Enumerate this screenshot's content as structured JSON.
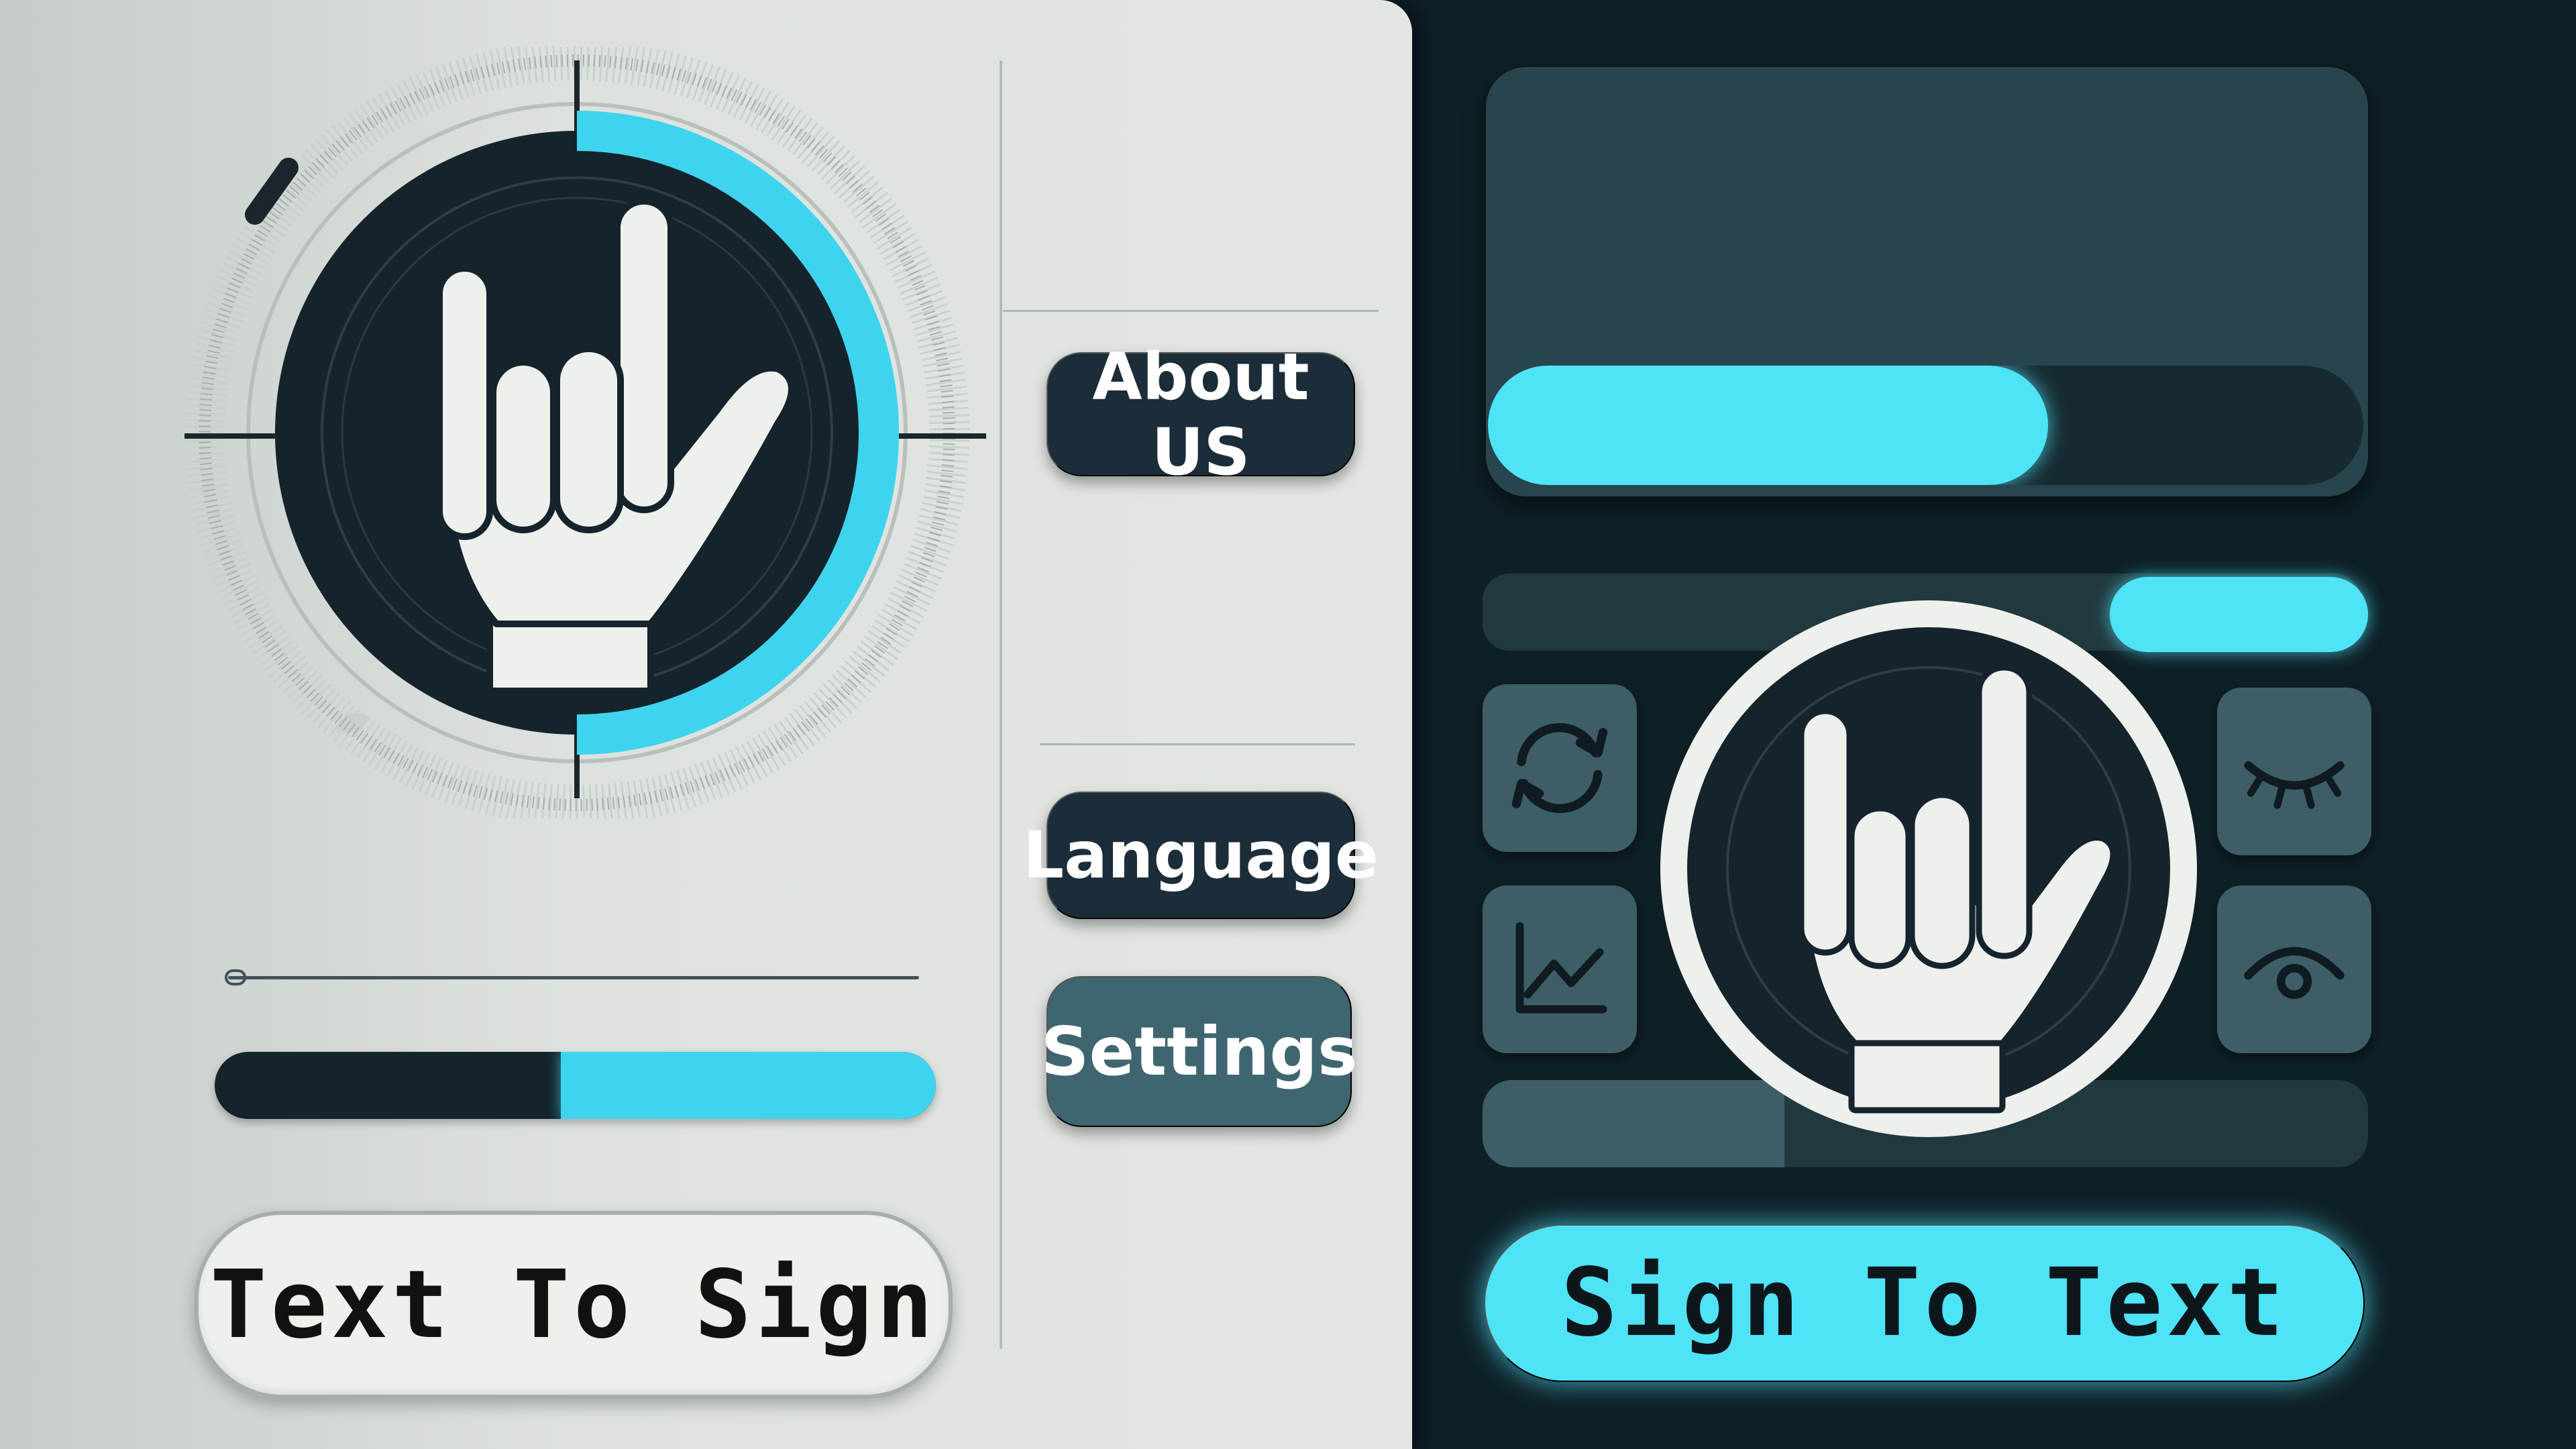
{
  "menu": {
    "about_label": "About US",
    "language_label": "Language",
    "settings_label": "Settings"
  },
  "actions": {
    "text_to_sign_label": "Text To Sign",
    "sign_to_text_label": "Sign To Text"
  },
  "progress": {
    "left_fill_fraction": 0.52,
    "right_fill_fraction": 0.64
  },
  "tiles": {
    "left": [
      "refresh-icon",
      "chart-icon"
    ],
    "right": [
      "eye-closed-icon",
      "eye-open-icon"
    ]
  },
  "colors": {
    "accent": "#4fe3f7",
    "dark": "#14232c",
    "slate": "#3f6670",
    "panel_light": "#dde2de"
  }
}
